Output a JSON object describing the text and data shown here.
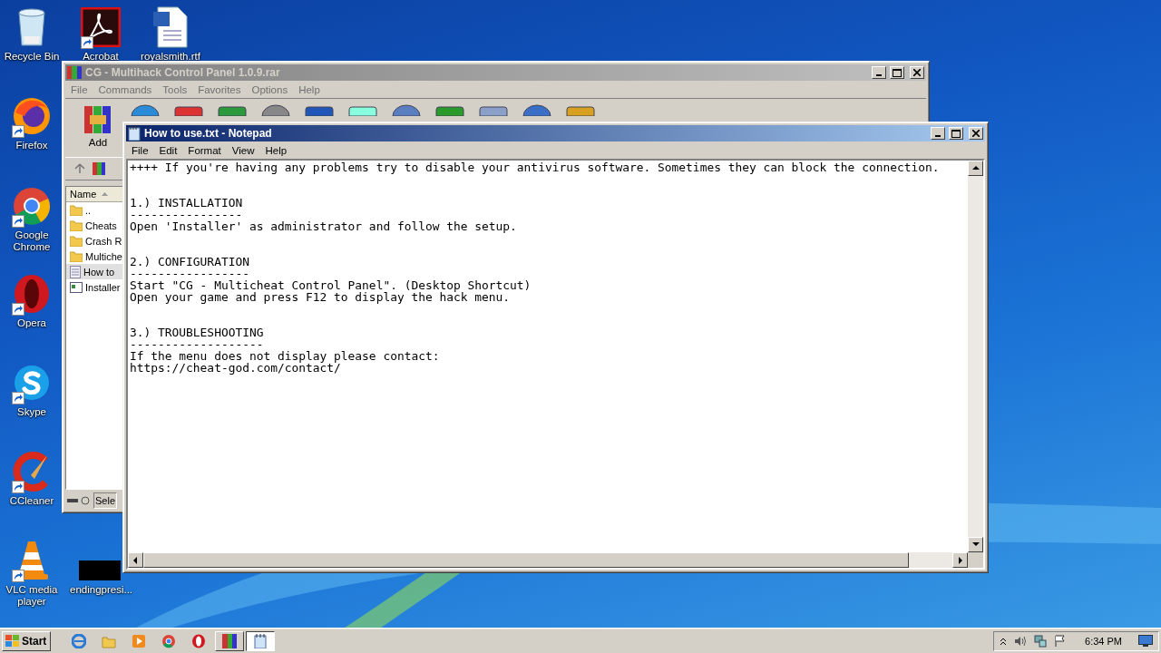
{
  "desktop_icons": [
    {
      "label": "Recycle Bin",
      "shortcut": false
    },
    {
      "label": "Acrobat",
      "shortcut": true
    },
    {
      "label": "royalsmith.rtf",
      "shortcut": false
    },
    {
      "label": "Firefox",
      "shortcut": true
    },
    {
      "label": "Google Chrome",
      "shortcut": true
    },
    {
      "label": "Opera",
      "shortcut": true
    },
    {
      "label": "Skype",
      "shortcut": true
    },
    {
      "label": "CCleaner",
      "shortcut": true
    },
    {
      "label": "VLC media player",
      "shortcut": true
    },
    {
      "label": "endingpresi...",
      "shortcut": false
    }
  ],
  "archive_window": {
    "title": "CG - Multihack Control Panel 1.0.9.rar",
    "active": false,
    "menu": [
      "File",
      "Commands",
      "Tools",
      "Favorites",
      "Options",
      "Help"
    ],
    "toolbar": [
      {
        "label": "Add"
      }
    ],
    "file_list": {
      "column": "Name",
      "items": [
        {
          "name": "..",
          "kind": "folder",
          "selected": false
        },
        {
          "name": "Cheats",
          "kind": "folder",
          "selected": false
        },
        {
          "name": "Crash R",
          "kind": "folder",
          "selected": false
        },
        {
          "name": "Multiche",
          "kind": "folder",
          "selected": false
        },
        {
          "name": "How to",
          "kind": "text",
          "selected": true
        },
        {
          "name": "Installer",
          "kind": "program",
          "selected": false
        }
      ]
    },
    "status_bar": "Sele"
  },
  "notepad": {
    "title": "How to use.txt - Notepad",
    "active": true,
    "menu": [
      "File",
      "Edit",
      "Format",
      "View",
      "Help"
    ],
    "intro": "++++ If you're having any problems try to disable your antivirus software. Sometimes they can block the connection.",
    "sections": [
      {
        "heading": "1.) INSTALLATION",
        "rule": "----------------",
        "lines": [
          "Open 'Installer' as administrator and follow the setup."
        ]
      },
      {
        "heading": "2.) CONFIGURATION",
        "rule": "-----------------",
        "lines": [
          "Start \"CG - Multicheat Control Panel\". (Desktop Shortcut)",
          "Open your game and press F12 to display the hack menu."
        ]
      },
      {
        "heading": "3.) TROUBLESHOOTING",
        "rule": "-------------------",
        "lines": [
          "If the menu does not display please contact:",
          "https://cheat-god.com/contact/"
        ]
      }
    ]
  },
  "taskbar": {
    "start": "Start",
    "window_buttons": [
      {
        "selected": false
      },
      {
        "selected": true
      }
    ],
    "clock": "6:34 PM"
  }
}
